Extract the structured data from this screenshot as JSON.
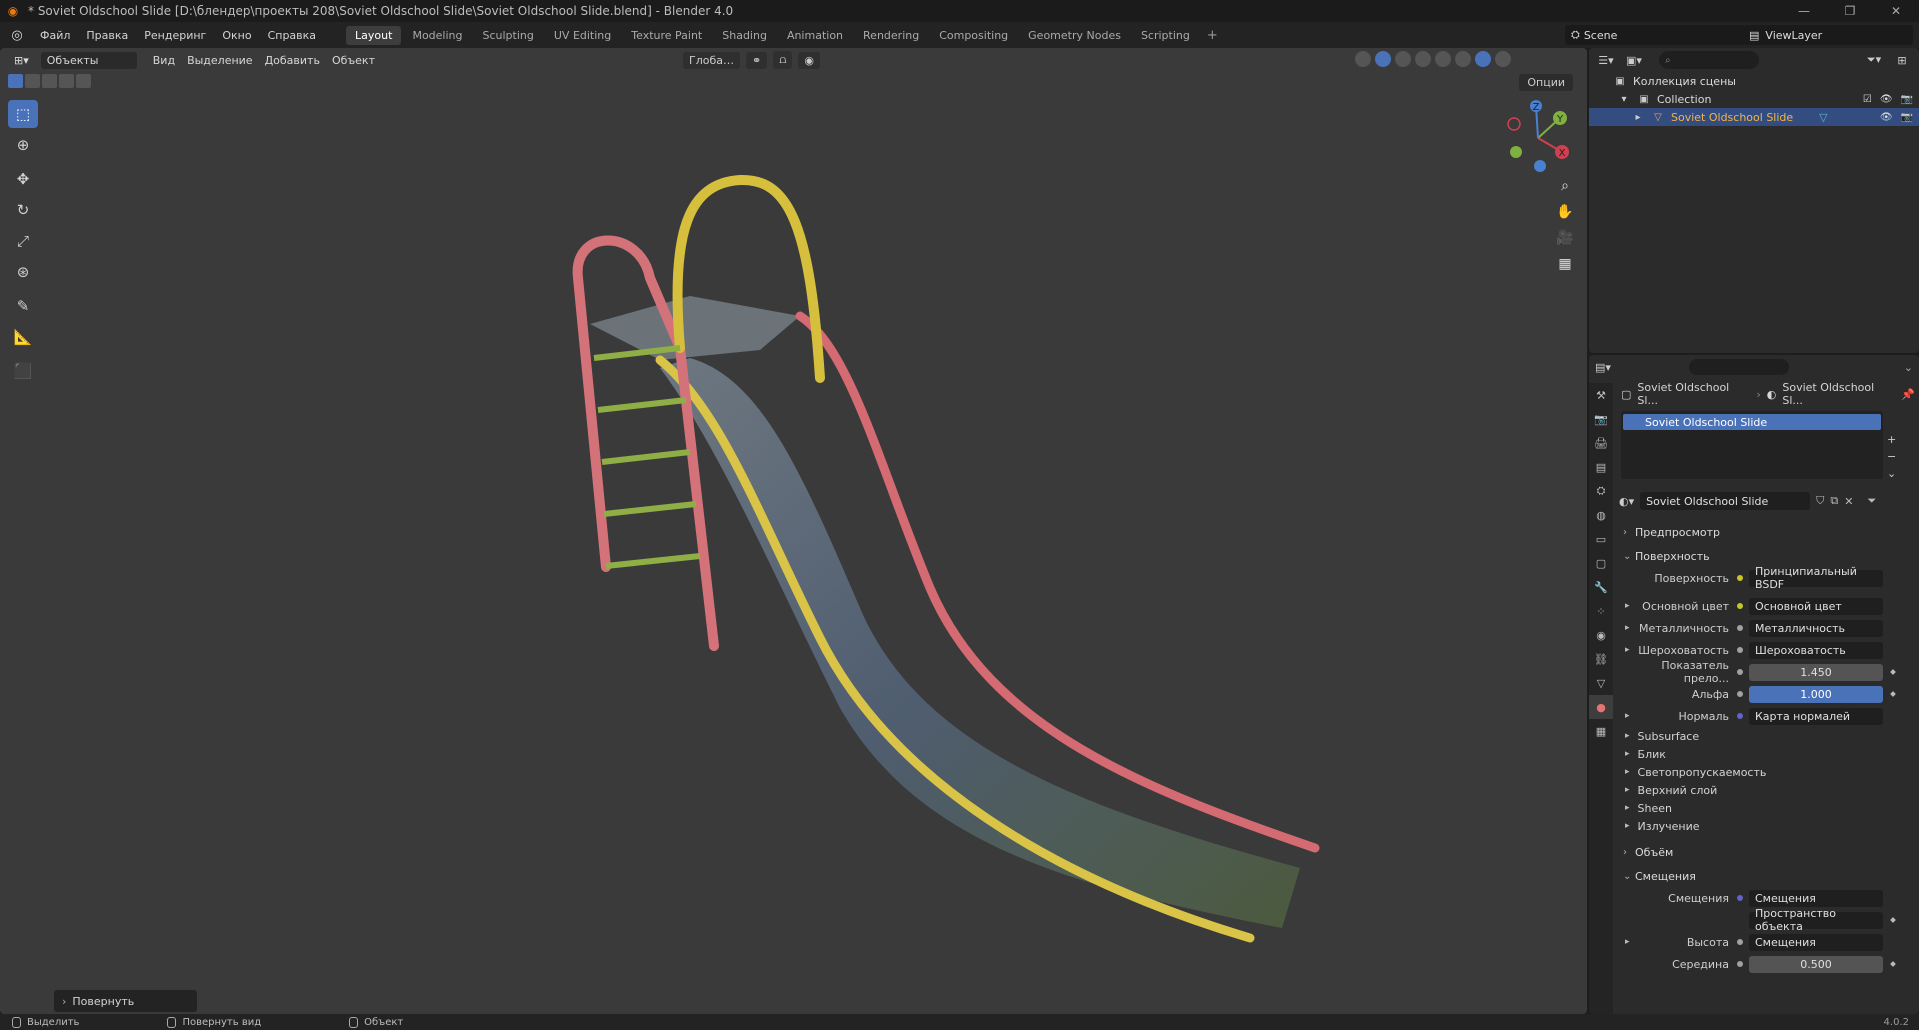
{
  "window": {
    "title": "* Soviet Oldschool Slide [D:\\блендер\\проекты 208\\Soviet Oldschool Slide\\Soviet Oldschool Slide.blend] - Blender 4.0",
    "minimize": "—",
    "maximize": "❐",
    "close": "✕"
  },
  "menu": {
    "items": [
      "Файл",
      "Правка",
      "Рендеринг",
      "Окно",
      "Справка"
    ]
  },
  "workspaces": [
    "Layout",
    "Modeling",
    "Sculpting",
    "UV Editing",
    "Texture Paint",
    "Shading",
    "Animation",
    "Rendering",
    "Compositing",
    "Geometry Nodes",
    "Scripting"
  ],
  "workspace_active": "Layout",
  "scene": {
    "name": "Scene",
    "view_layer": "ViewLayer"
  },
  "viewport": {
    "mode": "Объекты",
    "menus": [
      "Вид",
      "Выделение",
      "Добавить",
      "Объект"
    ],
    "transform_orientation": "Глоба…",
    "options": "Опции",
    "last_operator": "Повернуть",
    "gizmo_axes": [
      "X",
      "Y",
      "Z"
    ]
  },
  "outliner": {
    "search_placeholder": "",
    "root": "Коллекция сцены",
    "collection": "Collection",
    "object": "Soviet Oldschool Slide"
  },
  "properties": {
    "breadcrumb_object": "Soviet Oldschool Sl...",
    "breadcrumb_material": "Soviet Oldschool Sl...",
    "material_slot": "Soviet Oldschool Slide",
    "material_name": "Soviet Oldschool Slide",
    "panels": {
      "preview": "Предпросмотр",
      "surface": "Поверхность",
      "volume": "Объём",
      "displacement": "Смещения"
    },
    "surface_rows": [
      {
        "label": "Поверхность",
        "value": "Принципиальный BSDF"
      },
      {
        "label": "Основной цвет",
        "value": "Основной цвет"
      },
      {
        "label": "Металличность",
        "value": "Металличность"
      },
      {
        "label": "Шероховатость",
        "value": "Шероховатость"
      },
      {
        "label": "Показатель прело...",
        "value": "1.450"
      },
      {
        "label": "Альфа",
        "value": "1.000"
      },
      {
        "label": "Нормаль",
        "value": "Карта нормалей"
      }
    ],
    "subpanels": [
      "Subsurface",
      "Блик",
      "Светопропускаемость",
      "Верхний слой",
      "Sheen",
      "Излучение"
    ],
    "displacement_rows": [
      {
        "label": "Смещения",
        "value": "Смещения"
      },
      {
        "label": "",
        "value": "Пространство объекта"
      },
      {
        "label": "Высота",
        "value": "Смещения"
      },
      {
        "label": "Середина",
        "value": "0.500"
      }
    ]
  },
  "status": {
    "items": [
      "Выделить",
      "Повернуть вид",
      "Объект"
    ],
    "version": "4.0.2"
  },
  "colors": {
    "accent": "#4a72b8",
    "viewport_bg": "#3a3a3a",
    "panel_bg": "#2b2b2b"
  }
}
